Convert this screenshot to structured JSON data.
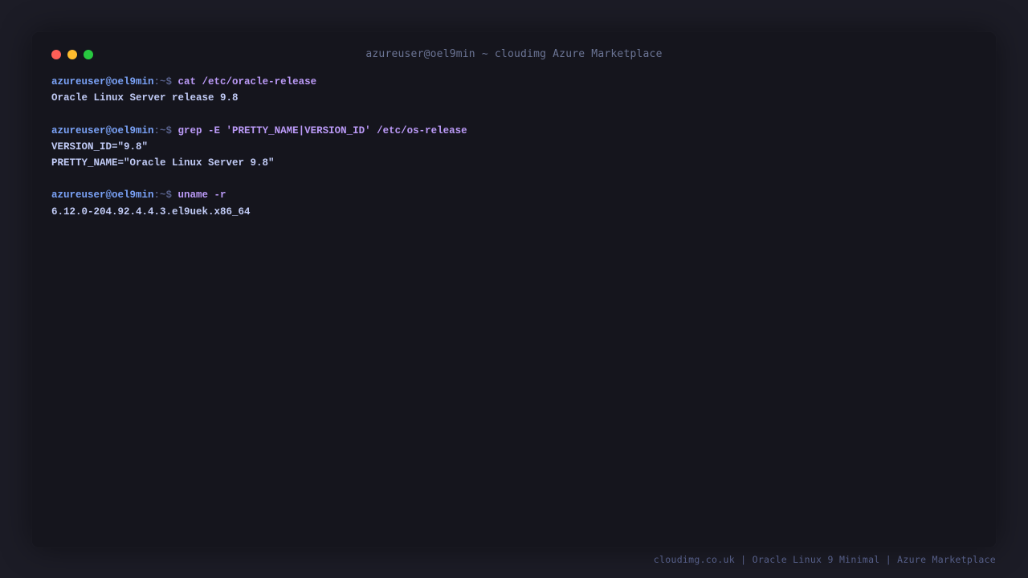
{
  "window": {
    "title": "azureuser@oel9min ~ cloudimg Azure Marketplace"
  },
  "terminal": {
    "prompt_user": "azureuser@oel9min",
    "prompt_path": ":~$ ",
    "sessions": [
      {
        "command": "cat /etc/oracle-release",
        "output": [
          "Oracle Linux Server release 9.8"
        ]
      },
      {
        "command": "grep -E 'PRETTY_NAME|VERSION_ID' /etc/os-release",
        "output": [
          "VERSION_ID=\"9.8\"",
          "PRETTY_NAME=\"Oracle Linux Server 9.8\""
        ]
      },
      {
        "command": "uname -r",
        "output": [
          "6.12.0-204.92.4.4.3.el9uek.x86_64"
        ]
      }
    ]
  },
  "footer": {
    "text": "cloudimg.co.uk | Oracle Linux 9 Minimal | Azure Marketplace"
  },
  "colors": {
    "background": "#1c1c26",
    "window": "#15151d",
    "prompt_user": "#7aa2f7",
    "prompt_path": "#565f89",
    "command": "#bb9af7",
    "output": "#c0caf5",
    "close": "#ff5f57",
    "minimize": "#febc2e",
    "zoom": "#28c840"
  }
}
